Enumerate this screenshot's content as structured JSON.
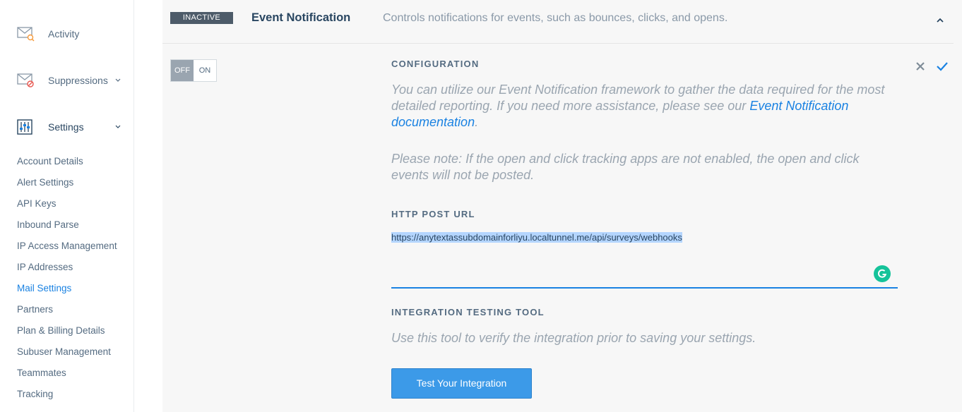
{
  "sidebar": {
    "main_items": [
      {
        "label": "Activity",
        "icon": "envelope-search-icon"
      },
      {
        "label": "Suppressions",
        "icon": "envelope-blocked-icon"
      },
      {
        "label": "Settings",
        "icon": "sliders-icon"
      }
    ],
    "settings_items": [
      {
        "label": "Account Details"
      },
      {
        "label": "Alert Settings"
      },
      {
        "label": "API Keys"
      },
      {
        "label": "Inbound Parse"
      },
      {
        "label": "IP Access Management"
      },
      {
        "label": "IP Addresses"
      },
      {
        "label": "Mail Settings",
        "active": true
      },
      {
        "label": "Partners"
      },
      {
        "label": "Plan & Billing Details"
      },
      {
        "label": "Subuser Management"
      },
      {
        "label": "Teammates"
      },
      {
        "label": "Tracking"
      }
    ]
  },
  "setting": {
    "status": "INACTIVE",
    "title": "Event Notification",
    "description": "Controls notifications for events, such as bounces, clicks, and opens.",
    "toggle": {
      "off_label": "OFF",
      "on_label": "ON",
      "state": "off"
    }
  },
  "configuration": {
    "heading": "CONFIGURATION",
    "intro": "You can utilize our Event Notification framework to gather the data required for the most detailed reporting. If you need more assistance, please see our ",
    "intro_link": "Event Notification documentation",
    "intro_end": ".",
    "note": "Please note: If the open and click tracking apps are not enabled, the open and click events will not be posted."
  },
  "http_post": {
    "heading": "HTTP POST URL",
    "value": "https://anytextassubdomainforliyu.localtunnel.me/api/surveys/webhooks"
  },
  "integration": {
    "heading": "INTEGRATION TESTING TOOL",
    "description": "Use this tool to verify the integration prior to saving your settings.",
    "button_label": "Test Your Integration"
  },
  "colors": {
    "accent": "#1a82e2",
    "badge": "#4d5b69",
    "button": "#3c9ae8"
  }
}
